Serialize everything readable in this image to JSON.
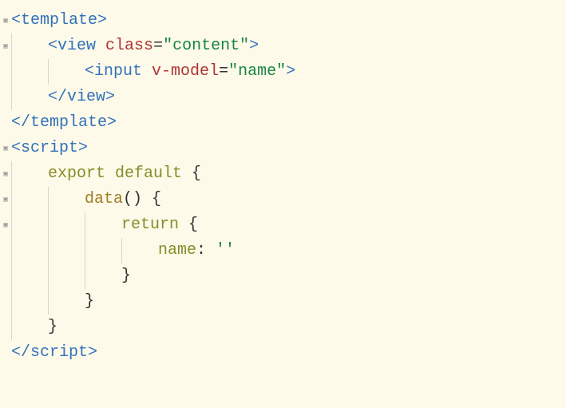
{
  "lines": [
    {
      "gutter": "fold",
      "indent": 0,
      "parts": [
        {
          "cls": "tag-bracket",
          "t": "<"
        },
        {
          "cls": "tag-name",
          "t": "template"
        },
        {
          "cls": "tag-bracket",
          "t": ">"
        }
      ]
    },
    {
      "gutter": "fold",
      "indent": 1,
      "parts": [
        {
          "cls": "tag-bracket",
          "t": "<"
        },
        {
          "cls": "tag-name",
          "t": "view"
        },
        {
          "cls": "plain",
          "t": " "
        },
        {
          "cls": "attr-name",
          "t": "class"
        },
        {
          "cls": "plain",
          "t": "="
        },
        {
          "cls": "attr-value",
          "t": "\"content\""
        },
        {
          "cls": "tag-bracket",
          "t": ">"
        }
      ]
    },
    {
      "gutter": "blank",
      "indent": 2,
      "parts": [
        {
          "cls": "tag-bracket",
          "t": "<"
        },
        {
          "cls": "tag-name",
          "t": "input"
        },
        {
          "cls": "plain",
          "t": " "
        },
        {
          "cls": "attr-name",
          "t": "v-model"
        },
        {
          "cls": "plain",
          "t": "="
        },
        {
          "cls": "attr-value",
          "t": "\"name\""
        },
        {
          "cls": "tag-bracket",
          "t": ">"
        }
      ]
    },
    {
      "gutter": "blank",
      "indent": 1,
      "parts": [
        {
          "cls": "tag-bracket",
          "t": "</"
        },
        {
          "cls": "tag-name",
          "t": "view"
        },
        {
          "cls": "tag-bracket",
          "t": ">"
        }
      ]
    },
    {
      "gutter": "blank",
      "indent": 0,
      "parts": [
        {
          "cls": "tag-bracket",
          "t": "</"
        },
        {
          "cls": "tag-name",
          "t": "template"
        },
        {
          "cls": "tag-bracket",
          "t": ">"
        }
      ]
    },
    {
      "gutter": "fold",
      "indent": 0,
      "parts": [
        {
          "cls": "tag-bracket",
          "t": "<"
        },
        {
          "cls": "tag-name",
          "t": "script"
        },
        {
          "cls": "tag-bracket",
          "t": ">"
        }
      ]
    },
    {
      "gutter": "fold",
      "indent": 1,
      "parts": [
        {
          "cls": "keyword",
          "t": "export default"
        },
        {
          "cls": "plain",
          "t": " "
        },
        {
          "cls": "brace",
          "t": "{"
        }
      ]
    },
    {
      "gutter": "fold",
      "indent": 2,
      "parts": [
        {
          "cls": "func-name",
          "t": "data"
        },
        {
          "cls": "brace",
          "t": "()"
        },
        {
          "cls": "plain",
          "t": " "
        },
        {
          "cls": "brace",
          "t": "{"
        }
      ]
    },
    {
      "gutter": "fold",
      "indent": 3,
      "parts": [
        {
          "cls": "keyword",
          "t": "return"
        },
        {
          "cls": "plain",
          "t": " "
        },
        {
          "cls": "brace",
          "t": "{"
        }
      ]
    },
    {
      "gutter": "blank",
      "indent": 4,
      "parts": [
        {
          "cls": "prop-name",
          "t": "name"
        },
        {
          "cls": "plain",
          "t": ": "
        },
        {
          "cls": "string",
          "t": "''"
        }
      ]
    },
    {
      "gutter": "blank",
      "indent": 3,
      "parts": [
        {
          "cls": "brace",
          "t": "}"
        }
      ]
    },
    {
      "gutter": "blank",
      "indent": 2,
      "parts": [
        {
          "cls": "brace",
          "t": "}"
        }
      ]
    },
    {
      "gutter": "blank",
      "indent": 1,
      "parts": [
        {
          "cls": "brace",
          "t": "}"
        }
      ]
    },
    {
      "gutter": "blank",
      "indent": 0,
      "parts": [
        {
          "cls": "tag-bracket",
          "t": "</"
        },
        {
          "cls": "tag-name",
          "t": "script"
        },
        {
          "cls": "tag-bracket",
          "t": ">"
        }
      ]
    }
  ]
}
